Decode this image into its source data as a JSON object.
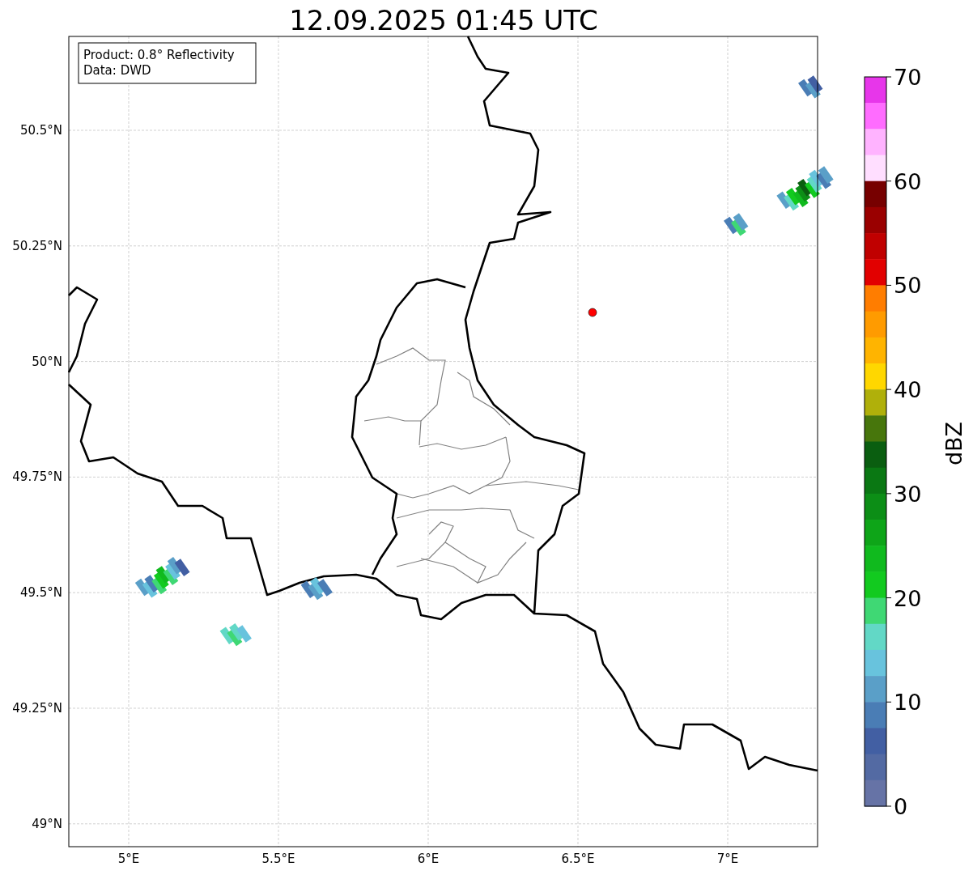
{
  "title": "12.09.2025 01:45 UTC",
  "info_box": [
    "Product: 0.8° Reflectivity",
    "Data: DWD"
  ],
  "map": {
    "x_ticks": [
      "5°E",
      "5.5°E",
      "6°E",
      "6.5°E",
      "7°E"
    ],
    "y_ticks": [
      "50.5°N",
      "50.25°N",
      "50°N",
      "49.75°N",
      "49.5°N",
      "49.25°N",
      "49°N"
    ]
  },
  "colorbar": {
    "label": "dBZ",
    "ticks": [
      "70",
      "60",
      "50",
      "40",
      "30",
      "20",
      "10",
      "0"
    ],
    "bands": [
      {
        "color": "#e736ea"
      },
      {
        "color": "#ff6cff"
      },
      {
        "color": "#ffb3ff"
      },
      {
        "color": "#ffdeff"
      },
      {
        "color": "#770000"
      },
      {
        "color": "#9a0000"
      },
      {
        "color": "#c00000"
      },
      {
        "color": "#e20000"
      },
      {
        "color": "#ff7d00"
      },
      {
        "color": "#ff9b00"
      },
      {
        "color": "#ffb400"
      },
      {
        "color": "#ffd700"
      },
      {
        "color": "#b0b00a"
      },
      {
        "color": "#47760c"
      },
      {
        "color": "#0a5e10"
      },
      {
        "color": "#0a7813"
      },
      {
        "color": "#0c8e16"
      },
      {
        "color": "#0ea518"
      },
      {
        "color": "#10ba1e"
      },
      {
        "color": "#12ca1f"
      },
      {
        "color": "#3fd874"
      },
      {
        "color": "#62d8c6"
      },
      {
        "color": "#68c3dd"
      },
      {
        "color": "#5a9fc8"
      },
      {
        "color": "#4a7db5"
      },
      {
        "color": "#425fa3"
      },
      {
        "color": "#536aa3"
      },
      {
        "color": "#6673a6"
      }
    ]
  }
}
